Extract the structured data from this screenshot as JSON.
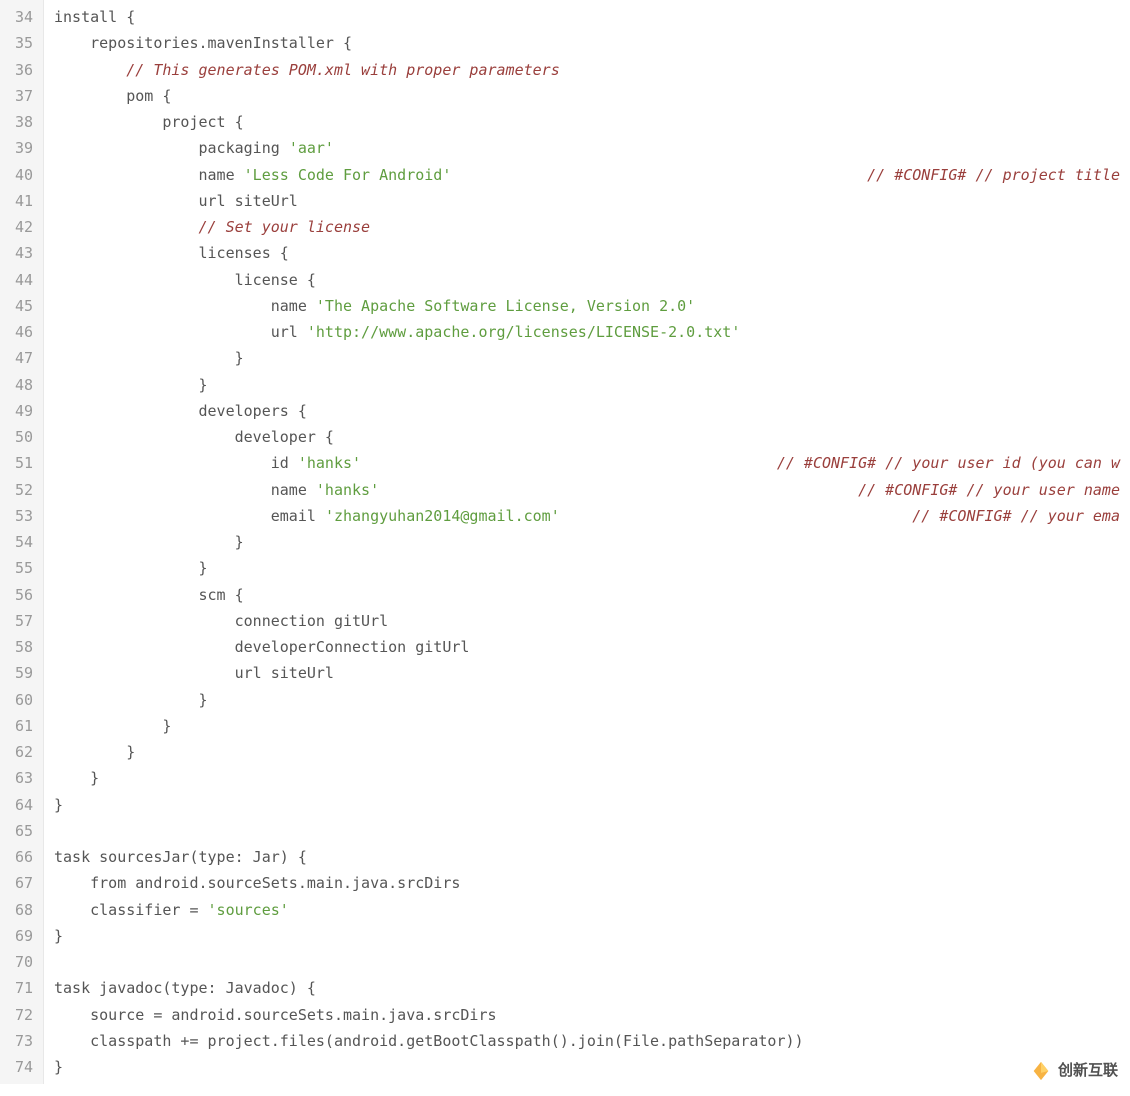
{
  "lines": [
    {
      "n": 34,
      "segs": [
        [
          "install {",
          "kw"
        ]
      ]
    },
    {
      "n": 35,
      "segs": [
        [
          "    repositories.mavenInstaller {",
          "kw"
        ]
      ]
    },
    {
      "n": 36,
      "segs": [
        [
          "        ",
          ""
        ],
        [
          "// This generates POM.xml with proper parameters",
          "comment"
        ]
      ]
    },
    {
      "n": 37,
      "segs": [
        [
          "        pom {",
          "kw"
        ]
      ]
    },
    {
      "n": 38,
      "segs": [
        [
          "            project {",
          "kw"
        ]
      ]
    },
    {
      "n": 39,
      "segs": [
        [
          "                packaging ",
          "kw"
        ],
        [
          "'aar'",
          "str"
        ]
      ]
    },
    {
      "n": 40,
      "segs": [
        [
          "                name ",
          "kw"
        ],
        [
          "'Less Code For Android'",
          "str"
        ]
      ],
      "right": "// #CONFIG# // project title"
    },
    {
      "n": 41,
      "segs": [
        [
          "                url siteUrl",
          "kw"
        ]
      ]
    },
    {
      "n": 42,
      "segs": [
        [
          "                ",
          ""
        ],
        [
          "// Set your license",
          "comment"
        ]
      ]
    },
    {
      "n": 43,
      "segs": [
        [
          "                licenses {",
          "kw"
        ]
      ]
    },
    {
      "n": 44,
      "segs": [
        [
          "                    license {",
          "kw"
        ]
      ]
    },
    {
      "n": 45,
      "segs": [
        [
          "                        name ",
          "kw"
        ],
        [
          "'The Apache Software License, Version 2.0'",
          "str"
        ]
      ]
    },
    {
      "n": 46,
      "segs": [
        [
          "                        url ",
          "kw"
        ],
        [
          "'http://www.apache.org/licenses/LICENSE-2.0.txt'",
          "str"
        ]
      ]
    },
    {
      "n": 47,
      "segs": [
        [
          "                    }",
          "kw"
        ]
      ]
    },
    {
      "n": 48,
      "segs": [
        [
          "                }",
          "kw"
        ]
      ]
    },
    {
      "n": 49,
      "segs": [
        [
          "                developers {",
          "kw"
        ]
      ]
    },
    {
      "n": 50,
      "segs": [
        [
          "                    developer {",
          "kw"
        ]
      ]
    },
    {
      "n": 51,
      "segs": [
        [
          "                        id ",
          "kw"
        ],
        [
          "'hanks'",
          "str"
        ]
      ],
      "right": "// #CONFIG# // your user id (you can w"
    },
    {
      "n": 52,
      "segs": [
        [
          "                        name ",
          "kw"
        ],
        [
          "'hanks'",
          "str"
        ]
      ],
      "right": "// #CONFIG# // your user name"
    },
    {
      "n": 53,
      "segs": [
        [
          "                        email ",
          "kw"
        ],
        [
          "'zhangyuhan2014@gmail.com'",
          "str"
        ]
      ],
      "right": "// #CONFIG# // your ema"
    },
    {
      "n": 54,
      "segs": [
        [
          "                    }",
          "kw"
        ]
      ]
    },
    {
      "n": 55,
      "segs": [
        [
          "                }",
          "kw"
        ]
      ]
    },
    {
      "n": 56,
      "segs": [
        [
          "                scm {",
          "kw"
        ]
      ]
    },
    {
      "n": 57,
      "segs": [
        [
          "                    connection gitUrl",
          "kw"
        ]
      ]
    },
    {
      "n": 58,
      "segs": [
        [
          "                    developerConnection gitUrl",
          "kw"
        ]
      ]
    },
    {
      "n": 59,
      "segs": [
        [
          "                    url siteUrl",
          "kw"
        ]
      ]
    },
    {
      "n": 60,
      "segs": [
        [
          "                }",
          "kw"
        ]
      ]
    },
    {
      "n": 61,
      "segs": [
        [
          "            }",
          "kw"
        ]
      ]
    },
    {
      "n": 62,
      "segs": [
        [
          "        }",
          "kw"
        ]
      ]
    },
    {
      "n": 63,
      "segs": [
        [
          "    }",
          "kw"
        ]
      ]
    },
    {
      "n": 64,
      "segs": [
        [
          "}",
          "kw"
        ]
      ]
    },
    {
      "n": 65,
      "segs": [
        [
          "",
          ""
        ]
      ]
    },
    {
      "n": 66,
      "segs": [
        [
          "task sourcesJar(type: Jar) {",
          "kw"
        ]
      ]
    },
    {
      "n": 67,
      "segs": [
        [
          "    from android.sourceSets.main.java.srcDirs",
          "kw"
        ]
      ]
    },
    {
      "n": 68,
      "segs": [
        [
          "    classifier = ",
          "kw"
        ],
        [
          "'sources'",
          "str"
        ]
      ]
    },
    {
      "n": 69,
      "segs": [
        [
          "}",
          "kw"
        ]
      ]
    },
    {
      "n": 70,
      "segs": [
        [
          "",
          ""
        ]
      ]
    },
    {
      "n": 71,
      "segs": [
        [
          "task javadoc(type: Javadoc) {",
          "kw"
        ]
      ]
    },
    {
      "n": 72,
      "segs": [
        [
          "    source = android.sourceSets.main.java.srcDirs",
          "kw"
        ]
      ]
    },
    {
      "n": 73,
      "segs": [
        [
          "    classpath += project.files(android.getBootClasspath().join(File.pathSeparator))",
          "kw"
        ]
      ]
    },
    {
      "n": 74,
      "segs": [
        [
          "}",
          "kw"
        ]
      ]
    }
  ],
  "watermark": {
    "text": "创新互联"
  }
}
